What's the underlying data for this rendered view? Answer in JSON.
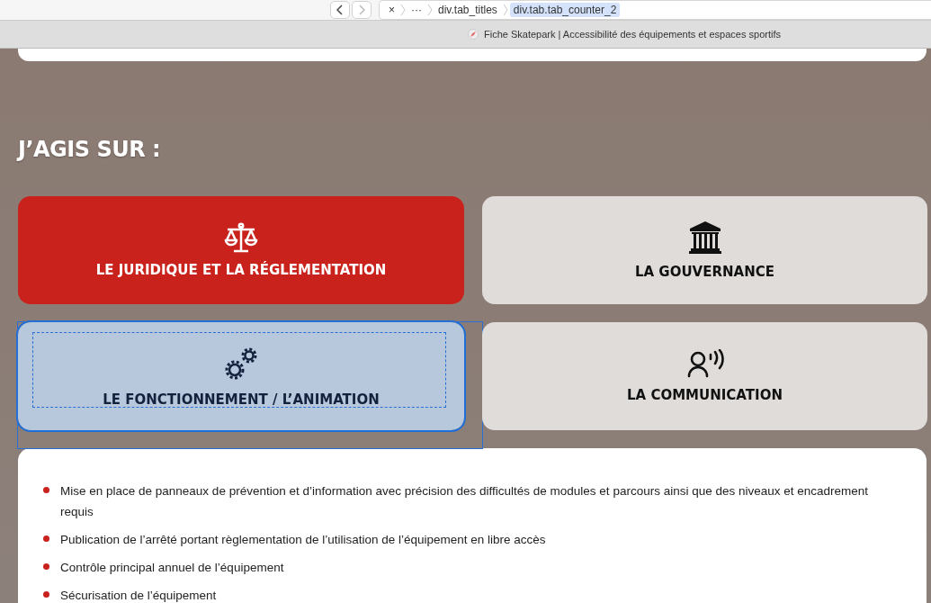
{
  "browser": {
    "breadcrumbs": [
      {
        "label": "×",
        "selected": false
      },
      {
        "label": "···",
        "selected": false
      },
      {
        "label": "div.tab_titles",
        "selected": false
      },
      {
        "label": "div.tab.tab_counter_2",
        "selected": true
      }
    ],
    "tab_title": "Fiche Skatepark | Accessibilité des équipements et espaces sportifs"
  },
  "heading": "J’AGIS SUR :",
  "tiles": [
    {
      "label": "LE JURIDIQUE ET LA RÉGLEMENTATION",
      "selected": true,
      "inspected": false
    },
    {
      "label": "LA GOUVERNANCE",
      "selected": false,
      "inspected": false
    },
    {
      "label": "LE FONCTIONNEMENT / L’ANIMATION",
      "selected": false,
      "inspected": true
    },
    {
      "label": "LA COMMUNICATION",
      "selected": false,
      "inspected": false
    }
  ],
  "items": [
    "Mise en place de panneaux de prévention et d’information avec précision des difficultés de modules et parcours ainsi que des niveaux et encadrement requis",
    "Publication de l’arrêté portant règlementation de l’utilisation de l’équipement en libre accès",
    "Contrôle principal annuel de l’équipement",
    "Sécurisation de l’équipement"
  ]
}
